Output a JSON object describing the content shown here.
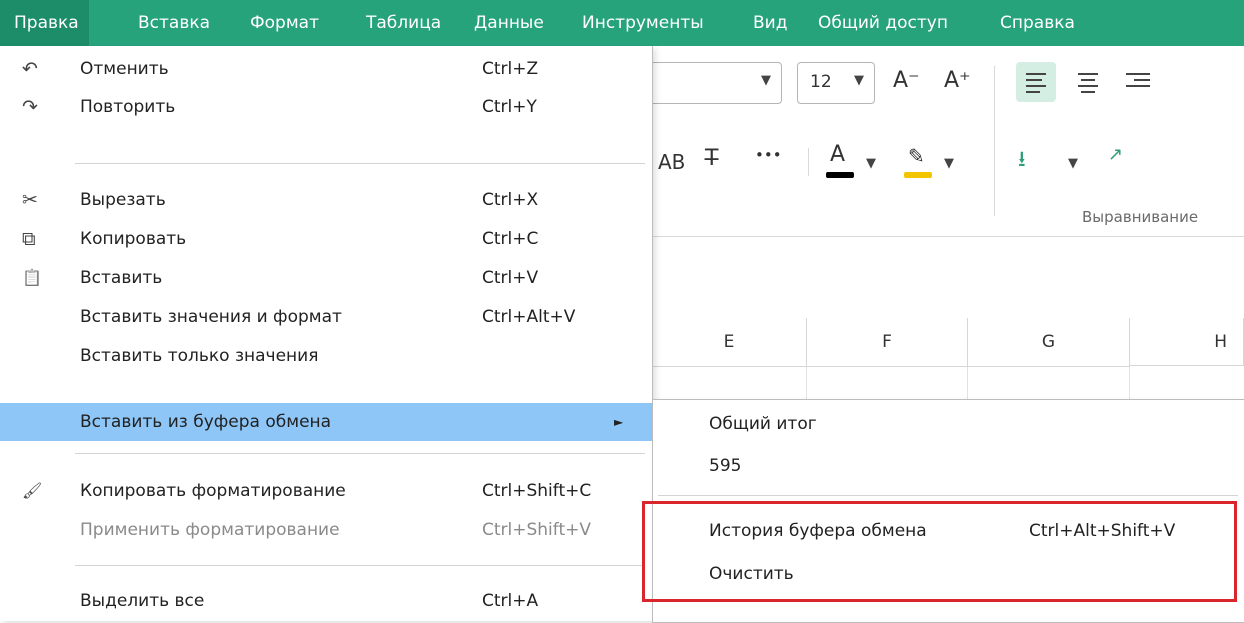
{
  "menubar": {
    "items": [
      "Правка",
      "Вставка",
      "Формат",
      "Таблица",
      "Данные",
      "Инструменты",
      "Вид",
      "Общий доступ",
      "Справка"
    ],
    "active": "Правка"
  },
  "toolbar": {
    "font_size": "12",
    "decrease_font": "A⁻",
    "increase_font": "A⁺",
    "case_btn": "АВ",
    "more_btn": "•••",
    "font_color_glyph": "A",
    "group_label_alignment": "Выравнивание"
  },
  "columns": [
    "E",
    "F",
    "G",
    "H"
  ],
  "menu": {
    "items": [
      {
        "label": "Отменить",
        "shortcut": "Ctrl+Z",
        "icon": "undo-icon",
        "glyph": "↶"
      },
      {
        "label": "Повторить",
        "shortcut": "Ctrl+Y",
        "icon": "redo-icon",
        "glyph": "↷"
      },
      {
        "label": "Вырезать",
        "shortcut": "Ctrl+X",
        "icon": "scissors-icon",
        "glyph": "✂"
      },
      {
        "label": "Копировать",
        "shortcut": "Ctrl+C",
        "icon": "copy-icon",
        "glyph": "⧉"
      },
      {
        "label": "Вставить",
        "shortcut": "Ctrl+V",
        "icon": "paste-icon",
        "glyph": "📋"
      },
      {
        "label": "Вставить значения и формат",
        "shortcut": "Ctrl+Alt+V"
      },
      {
        "label": "Вставить только значения",
        "shortcut": ""
      },
      {
        "label": "Вставить из буфера обмена",
        "shortcut": "",
        "arrow": "►"
      },
      {
        "label": "Копировать форматирование",
        "shortcut": "Ctrl+Shift+C",
        "icon": "format-painter-icon",
        "glyph": "🖌"
      },
      {
        "label": "Применить форматирование",
        "shortcut": "Ctrl+Shift+V"
      },
      {
        "label": "Выделить все",
        "shortcut": "Ctrl+A"
      }
    ]
  },
  "submenu": {
    "item1": "Общий итог",
    "item2": "595",
    "history_label": "История буфера обмена",
    "history_shortcut": "Ctrl+Alt+Shift+V",
    "clear_label": "Очистить"
  },
  "colors": {
    "menubar": "#27a37c",
    "highlight": "#8ec7f7",
    "red_frame": "#d9262d",
    "font_color_bar": "#000000",
    "highlight_bar": "#f2c500"
  }
}
